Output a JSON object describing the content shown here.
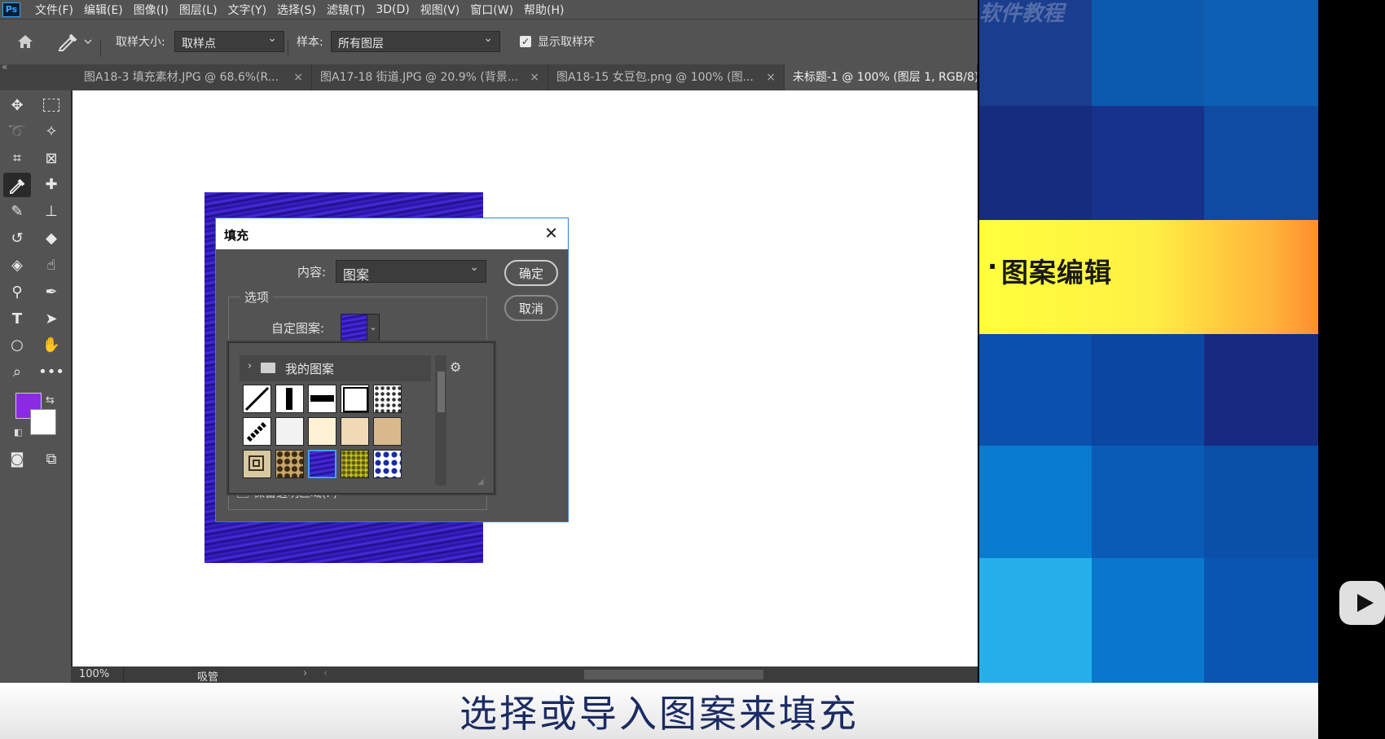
{
  "app": {
    "logo": "Ps",
    "menu": [
      "文件(F)",
      "编辑(E)",
      "图像(I)",
      "图层(L)",
      "文字(Y)",
      "选择(S)",
      "滤镜(T)",
      "3D(D)",
      "视图(V)",
      "窗口(W)",
      "帮助(H)"
    ]
  },
  "options_bar": {
    "sample_size_label": "取样大小:",
    "sample_size_value": "取样点",
    "sample_label": "样本:",
    "sample_value": "所有图层",
    "show_ring_label": "显示取样环",
    "show_ring_checked": true
  },
  "tabs": [
    {
      "label": "图A18-3 填充素材.JPG @ 68.6%(R...",
      "close": "×"
    },
    {
      "label": "图A17-18 街道.JPG @ 20.9% (背景...",
      "close": "×"
    },
    {
      "label": "图A18-15 女豆包.png @ 100% (图...",
      "close": "×"
    },
    {
      "label": "未标题-1 @ 100% (图层 1, RGB/8)",
      "close": ""
    }
  ],
  "colors": {
    "foreground": "#8a2be2",
    "background": "#ffffff",
    "pattern": "#2c1aaa",
    "accent_border": "#2f7fd6"
  },
  "dialog": {
    "title": "填充",
    "close": "✕",
    "content_label": "内容:",
    "content_value": "图案",
    "options_legend": "选项",
    "custom_pattern_label": "自定图案:",
    "ok_label": "确定",
    "cancel_label": "取消",
    "hidden_checkbox_label": "保留透明区域(P)"
  },
  "pattern_picker": {
    "folder_label": "我的图案",
    "swatches": [
      "diagonal-line",
      "vertical-bar",
      "horizontal-bar",
      "square-frame",
      "polka-dots",
      "diagonal-dash",
      "white-noise",
      "cream",
      "beige",
      "sand",
      "concentric-squares",
      "leopard",
      "blue-wave",
      "yellow-texture",
      "blue-white-pattern"
    ],
    "selected_index": 12
  },
  "status": {
    "zoom": "100%",
    "tool": "吸管"
  },
  "slide": {
    "watermark": "软件教程",
    "heading": "图案编辑"
  },
  "caption": "选择或导入图案来填充"
}
